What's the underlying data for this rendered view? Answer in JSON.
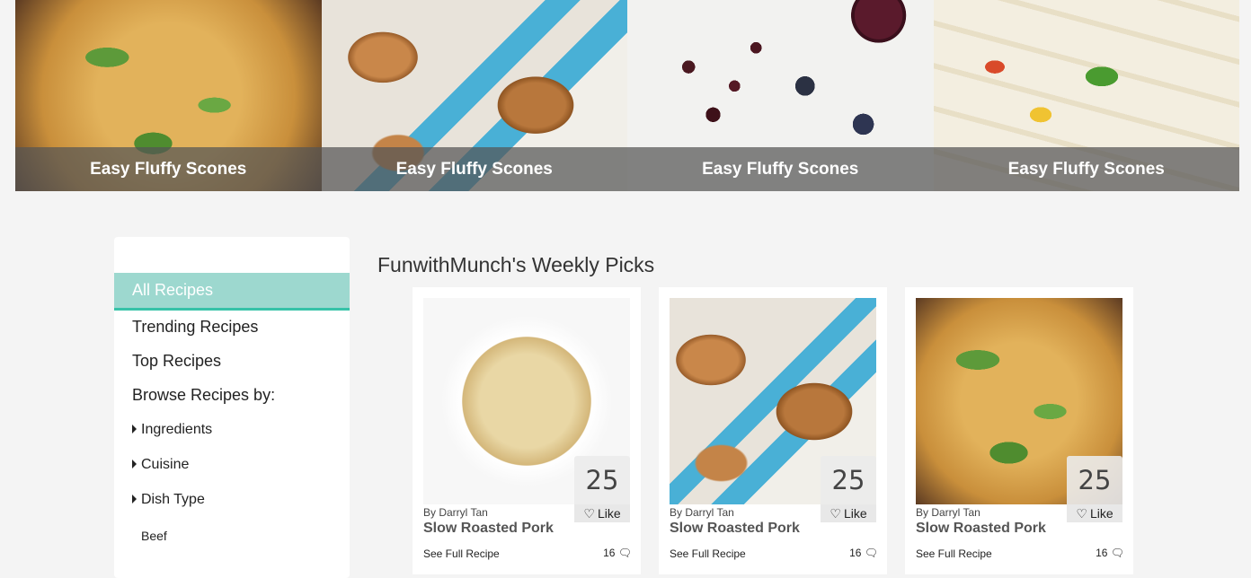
{
  "hero": {
    "tiles": [
      {
        "caption": "Easy Fluffy Scones",
        "image": "casserole"
      },
      {
        "caption": "Easy Fluffy Scones",
        "image": "scones"
      },
      {
        "caption": "Easy Fluffy Scones",
        "image": "berries"
      },
      {
        "caption": "Easy Fluffy Scones",
        "image": "squid"
      }
    ]
  },
  "sidebar": {
    "active": "All Recipes",
    "trending": "Trending Recipes",
    "top": "Top Recipes",
    "browse_heading": "Browse Recipes by:",
    "ingredients": "Ingredients",
    "cuisine": "Cuisine",
    "dish_type": "Dish Type",
    "beef": "Beef"
  },
  "picks": {
    "title": "FunwithMunch's Weekly Picks",
    "cards": [
      {
        "count": "25",
        "like": "Like",
        "by": "By Darryl Tan",
        "name": "Slow Roasted Pork",
        "full": "See Full Recipe",
        "comments": "16",
        "image": "pasta"
      },
      {
        "count": "25",
        "like": "Like",
        "by": "By Darryl Tan",
        "name": "Slow Roasted Pork",
        "full": "See Full Recipe",
        "comments": "16",
        "image": "scones"
      },
      {
        "count": "25",
        "like": "Like",
        "by": "By Darryl Tan",
        "name": "Slow Roasted Pork",
        "full": "See Full Recipe",
        "comments": "16",
        "image": "casserole"
      }
    ]
  },
  "icons": {
    "heart": "heart-icon",
    "comment": "comment-icon",
    "caret": "caret-right-icon"
  }
}
